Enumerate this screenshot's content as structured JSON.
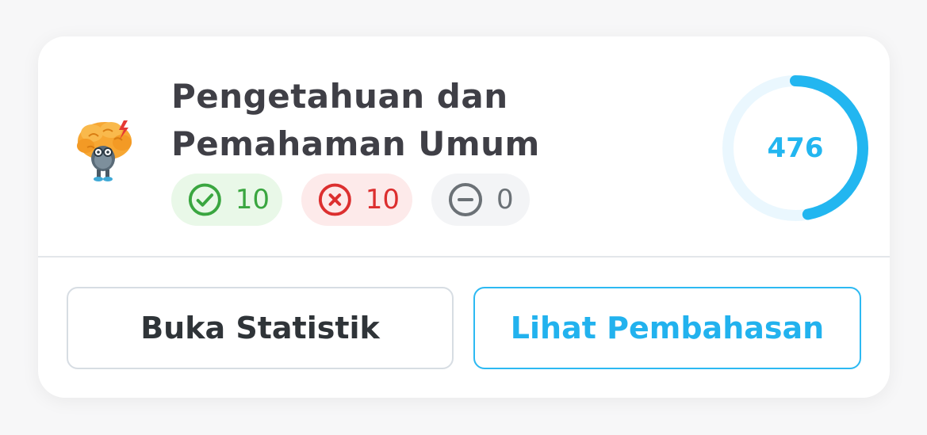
{
  "card": {
    "title": "Pengetahuan dan Pemahaman Umum",
    "avatar_icon": "brain-mascot-icon",
    "stats": {
      "correct": {
        "value": "10",
        "icon": "check-circle-icon",
        "color": "#3aa640",
        "bg": "#e9f8e8"
      },
      "wrong": {
        "value": "10",
        "icon": "x-circle-icon",
        "color": "#dc2f2f",
        "bg": "#fdeaea"
      },
      "empty": {
        "value": "0",
        "icon": "minus-circle-icon",
        "color": "#6b7176",
        "bg": "#f3f4f6"
      }
    },
    "score": {
      "value": "476",
      "progress_fraction": 0.47,
      "ring_color": "#22b6f0",
      "track_color": "#eaf7fe"
    }
  },
  "actions": {
    "stats_label": "Buka Statistik",
    "review_label": "Lihat Pembahasan"
  }
}
